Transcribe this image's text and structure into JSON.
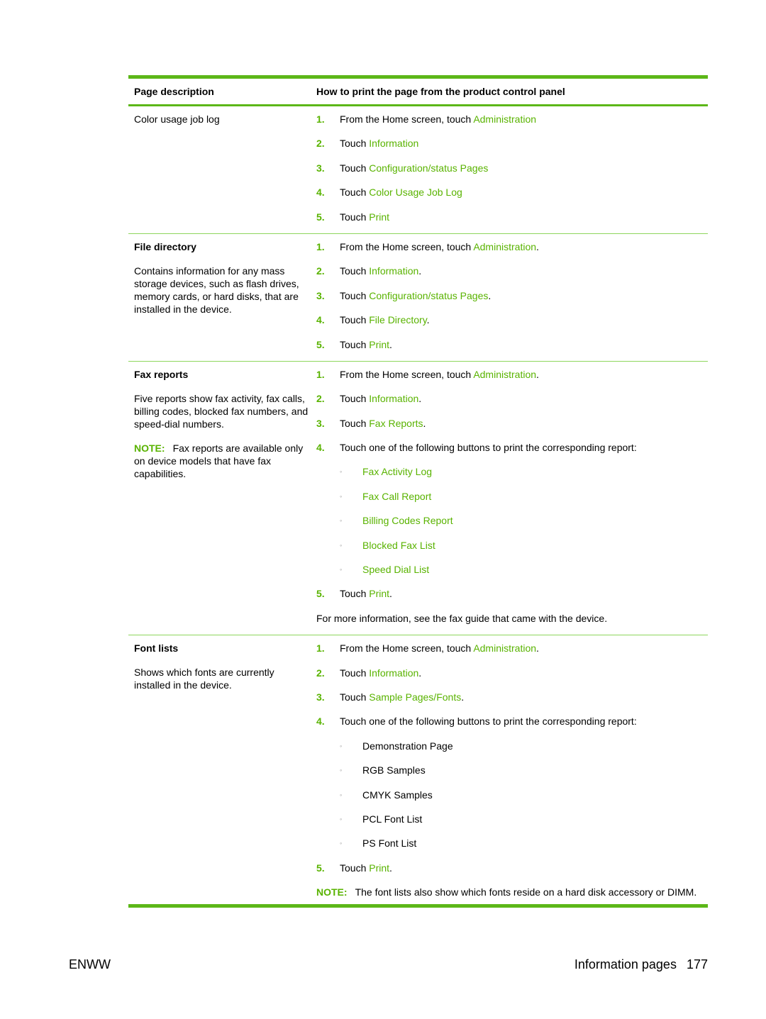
{
  "table": {
    "headers": [
      "Page description",
      "How to print the page from the product control panel"
    ],
    "colors": {
      "accent": "#59b300",
      "rule": "#5cb718",
      "separator": "#8ed65c"
    },
    "rows": [
      {
        "title": "Color usage job log",
        "steps": [
          {
            "num": "1.",
            "text": "From the Home screen, touch ",
            "link": "Administration",
            "suffix": ""
          },
          {
            "num": "2.",
            "text": "Touch ",
            "link": "Information",
            "suffix": ""
          },
          {
            "num": "3.",
            "text": "Touch ",
            "link": "Configuration/status Pages",
            "suffix": ""
          },
          {
            "num": "4.",
            "text": "Touch ",
            "link": "Color Usage Job Log",
            "suffix": ""
          },
          {
            "num": "5.",
            "text": "Touch ",
            "link": "Print",
            "suffix": ""
          }
        ]
      },
      {
        "title": "File directory",
        "description": "Contains information for any mass storage devices, such as flash drives, memory cards, or hard disks, that are installed in the device.",
        "steps": [
          {
            "num": "1.",
            "text": "From the Home screen, touch ",
            "link": "Administration",
            "suffix": "."
          },
          {
            "num": "2.",
            "text": "Touch ",
            "link": "Information",
            "suffix": "."
          },
          {
            "num": "3.",
            "text": "Touch ",
            "link": "Configuration/status Pages",
            "suffix": "."
          },
          {
            "num": "4.",
            "text": "Touch ",
            "link": "File Directory",
            "suffix": "."
          },
          {
            "num": "5.",
            "text": "Touch ",
            "link": "Print",
            "suffix": "."
          }
        ]
      },
      {
        "title": "Fax reports",
        "description": "Five reports show fax activity, fax calls, billing codes, blocked fax numbers, and speed-dial numbers.",
        "note_label": "NOTE:",
        "note": "Fax reports are available only on device models that have fax capabilities.",
        "steps": [
          {
            "num": "1.",
            "text": "From the Home screen, touch ",
            "link": "Administration",
            "suffix": "."
          },
          {
            "num": "2.",
            "text": "Touch ",
            "link": "Information",
            "suffix": "."
          },
          {
            "num": "3.",
            "text": "Touch ",
            "link": "Fax Reports",
            "suffix": "."
          },
          {
            "num": "4.",
            "text": "Touch one of the following buttons to print the corresponding report:"
          },
          {
            "num": "5.",
            "text": "Touch ",
            "link": "Print",
            "suffix": "."
          }
        ],
        "sub_items": [
          "Fax Activity Log",
          "Fax Call Report",
          "Billing Codes Report",
          "Blocked Fax List",
          "Speed Dial List"
        ],
        "bullet": "◦",
        "footer_text": "For more information, see the fax guide that came with the device."
      },
      {
        "title": "Font lists",
        "description": "Shows which fonts are currently installed in the device.",
        "steps": [
          {
            "num": "1.",
            "text": "From the Home screen, touch ",
            "link": "Administration",
            "suffix": "."
          },
          {
            "num": "2.",
            "text": "Touch ",
            "link": "Information",
            "suffix": "."
          },
          {
            "num": "3.",
            "text": "Touch ",
            "link": "Sample Pages/Fonts",
            "suffix": "."
          },
          {
            "num": "4.",
            "text": "Touch one of the following buttons to print the corresponding report:"
          },
          {
            "num": "5.",
            "text": "Touch ",
            "link": "Print",
            "suffix": "."
          }
        ],
        "sub_items": [
          "Demonstration Page",
          "RGB Samples",
          "CMYK Samples",
          "PCL Font List",
          "PS Font List"
        ],
        "bullet": "◦",
        "note_label": "NOTE:",
        "note": "The font lists also show which fonts reside on a hard disk accessory or DIMM."
      }
    ]
  },
  "footer": {
    "left": "ENWW",
    "section": "Information pages",
    "page_number": "177"
  }
}
